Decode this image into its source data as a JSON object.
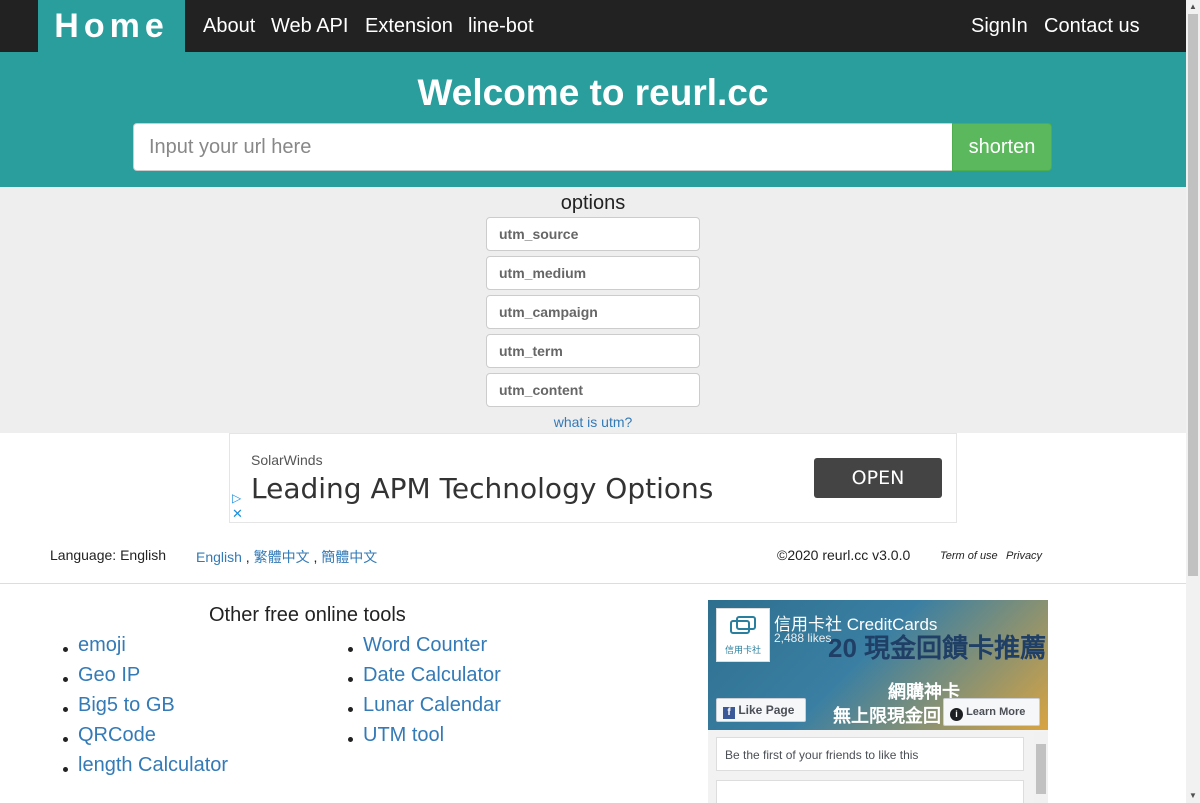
{
  "navbar": {
    "brand": "Home",
    "links": [
      "About",
      "Web API",
      "Extension",
      "line-bot"
    ],
    "right_links": [
      "SignIn",
      "Contact us"
    ]
  },
  "hero": {
    "title": "Welcome to reurl.cc",
    "url_placeholder": "Input your url here",
    "url_value": "",
    "shorten_label": "shorten"
  },
  "options": {
    "title": "options",
    "fields": [
      {
        "placeholder": "utm_source",
        "value": ""
      },
      {
        "placeholder": "utm_medium",
        "value": ""
      },
      {
        "placeholder": "utm_campaign",
        "value": ""
      },
      {
        "placeholder": "utm_term",
        "value": ""
      },
      {
        "placeholder": "utm_content",
        "value": ""
      }
    ],
    "what_is_utm": "what is utm?"
  },
  "ad": {
    "sponsor": "SolarWinds",
    "headline": "Leading APM Technology Options",
    "cta": "OPEN",
    "play_icon": "▷",
    "close_icon": "✕"
  },
  "footer": {
    "language_label": "Language: English",
    "languages": [
      "English",
      "繁體中文",
      "簡體中文"
    ],
    "separator": " , ",
    "copyright": "©2020 reurl.cc v3.0.0",
    "term": "Term of use",
    "privacy": "Privacy"
  },
  "tools": {
    "title": "Other free online tools",
    "left": [
      "emoji",
      "Geo IP",
      "Big5 to GB",
      "QRCode",
      "length Calculator"
    ],
    "right": [
      "Word Counter",
      "Date Calculator",
      "Lunar Calendar",
      "UTM tool"
    ]
  },
  "facebook": {
    "page_name": "信用卡社 CreditCards",
    "likes": "2,488 likes",
    "logo_text": "信用卡社",
    "cover_text_1": "20 現金回饋卡推薦",
    "cover_text_2": "網購神卡",
    "cover_text_3": "無上限現金回",
    "like_button": "Like Page",
    "learn_button": "Learn More",
    "friends_text": "Be the first of your friends to like this"
  },
  "colors": {
    "teal": "#2a9d9d",
    "navbar": "#222222",
    "success": "#5cb85c",
    "link": "#337ab7"
  }
}
